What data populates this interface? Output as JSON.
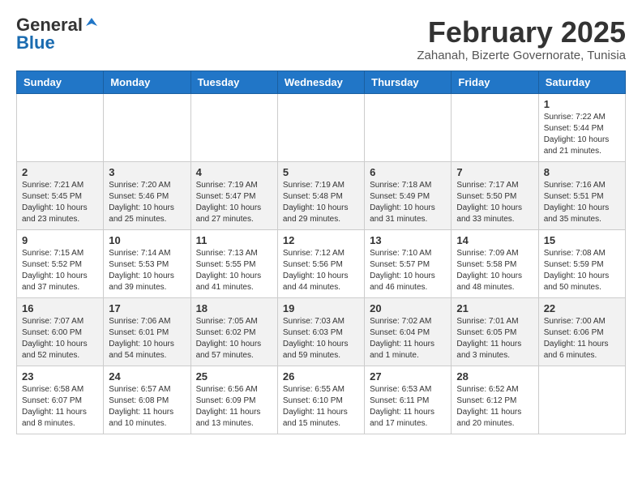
{
  "header": {
    "logo_general": "General",
    "logo_blue": "Blue",
    "month_title": "February 2025",
    "location": "Zahanah, Bizerte Governorate, Tunisia"
  },
  "weekdays": [
    "Sunday",
    "Monday",
    "Tuesday",
    "Wednesday",
    "Thursday",
    "Friday",
    "Saturday"
  ],
  "weeks": [
    [
      {
        "day": "",
        "info": ""
      },
      {
        "day": "",
        "info": ""
      },
      {
        "day": "",
        "info": ""
      },
      {
        "day": "",
        "info": ""
      },
      {
        "day": "",
        "info": ""
      },
      {
        "day": "",
        "info": ""
      },
      {
        "day": "1",
        "info": "Sunrise: 7:22 AM\nSunset: 5:44 PM\nDaylight: 10 hours\nand 21 minutes."
      }
    ],
    [
      {
        "day": "2",
        "info": "Sunrise: 7:21 AM\nSunset: 5:45 PM\nDaylight: 10 hours\nand 23 minutes."
      },
      {
        "day": "3",
        "info": "Sunrise: 7:20 AM\nSunset: 5:46 PM\nDaylight: 10 hours\nand 25 minutes."
      },
      {
        "day": "4",
        "info": "Sunrise: 7:19 AM\nSunset: 5:47 PM\nDaylight: 10 hours\nand 27 minutes."
      },
      {
        "day": "5",
        "info": "Sunrise: 7:19 AM\nSunset: 5:48 PM\nDaylight: 10 hours\nand 29 minutes."
      },
      {
        "day": "6",
        "info": "Sunrise: 7:18 AM\nSunset: 5:49 PM\nDaylight: 10 hours\nand 31 minutes."
      },
      {
        "day": "7",
        "info": "Sunrise: 7:17 AM\nSunset: 5:50 PM\nDaylight: 10 hours\nand 33 minutes."
      },
      {
        "day": "8",
        "info": "Sunrise: 7:16 AM\nSunset: 5:51 PM\nDaylight: 10 hours\nand 35 minutes."
      }
    ],
    [
      {
        "day": "9",
        "info": "Sunrise: 7:15 AM\nSunset: 5:52 PM\nDaylight: 10 hours\nand 37 minutes."
      },
      {
        "day": "10",
        "info": "Sunrise: 7:14 AM\nSunset: 5:53 PM\nDaylight: 10 hours\nand 39 minutes."
      },
      {
        "day": "11",
        "info": "Sunrise: 7:13 AM\nSunset: 5:55 PM\nDaylight: 10 hours\nand 41 minutes."
      },
      {
        "day": "12",
        "info": "Sunrise: 7:12 AM\nSunset: 5:56 PM\nDaylight: 10 hours\nand 44 minutes."
      },
      {
        "day": "13",
        "info": "Sunrise: 7:10 AM\nSunset: 5:57 PM\nDaylight: 10 hours\nand 46 minutes."
      },
      {
        "day": "14",
        "info": "Sunrise: 7:09 AM\nSunset: 5:58 PM\nDaylight: 10 hours\nand 48 minutes."
      },
      {
        "day": "15",
        "info": "Sunrise: 7:08 AM\nSunset: 5:59 PM\nDaylight: 10 hours\nand 50 minutes."
      }
    ],
    [
      {
        "day": "16",
        "info": "Sunrise: 7:07 AM\nSunset: 6:00 PM\nDaylight: 10 hours\nand 52 minutes."
      },
      {
        "day": "17",
        "info": "Sunrise: 7:06 AM\nSunset: 6:01 PM\nDaylight: 10 hours\nand 54 minutes."
      },
      {
        "day": "18",
        "info": "Sunrise: 7:05 AM\nSunset: 6:02 PM\nDaylight: 10 hours\nand 57 minutes."
      },
      {
        "day": "19",
        "info": "Sunrise: 7:03 AM\nSunset: 6:03 PM\nDaylight: 10 hours\nand 59 minutes."
      },
      {
        "day": "20",
        "info": "Sunrise: 7:02 AM\nSunset: 6:04 PM\nDaylight: 11 hours\nand 1 minute."
      },
      {
        "day": "21",
        "info": "Sunrise: 7:01 AM\nSunset: 6:05 PM\nDaylight: 11 hours\nand 3 minutes."
      },
      {
        "day": "22",
        "info": "Sunrise: 7:00 AM\nSunset: 6:06 PM\nDaylight: 11 hours\nand 6 minutes."
      }
    ],
    [
      {
        "day": "23",
        "info": "Sunrise: 6:58 AM\nSunset: 6:07 PM\nDaylight: 11 hours\nand 8 minutes."
      },
      {
        "day": "24",
        "info": "Sunrise: 6:57 AM\nSunset: 6:08 PM\nDaylight: 11 hours\nand 10 minutes."
      },
      {
        "day": "25",
        "info": "Sunrise: 6:56 AM\nSunset: 6:09 PM\nDaylight: 11 hours\nand 13 minutes."
      },
      {
        "day": "26",
        "info": "Sunrise: 6:55 AM\nSunset: 6:10 PM\nDaylight: 11 hours\nand 15 minutes."
      },
      {
        "day": "27",
        "info": "Sunrise: 6:53 AM\nSunset: 6:11 PM\nDaylight: 11 hours\nand 17 minutes."
      },
      {
        "day": "28",
        "info": "Sunrise: 6:52 AM\nSunset: 6:12 PM\nDaylight: 11 hours\nand 20 minutes."
      },
      {
        "day": "",
        "info": ""
      }
    ]
  ]
}
